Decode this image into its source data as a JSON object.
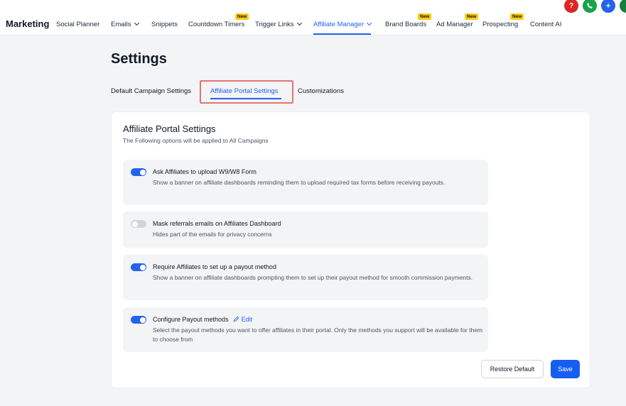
{
  "nav": {
    "brand": "Marketing",
    "items": [
      {
        "label": "Social Planner"
      },
      {
        "label": "Emails"
      },
      {
        "label": "Snippets"
      },
      {
        "label": "Countdown Timers",
        "badge": "New"
      },
      {
        "label": "Trigger Links"
      },
      {
        "label": "Affiliate Manager"
      },
      {
        "label": "Brand Boards",
        "badge": "New"
      },
      {
        "label": "Ad Manager",
        "badge": "New"
      },
      {
        "label": "Prospecting",
        "badge": "New"
      },
      {
        "label": "Content AI"
      }
    ],
    "colors": {
      "active": "#2563eb",
      "badge": "#facc15"
    }
  },
  "header_buttons": [
    {
      "icon": "help-icon",
      "color": "#dc2626"
    },
    {
      "icon": "phone-icon",
      "color": "#16a34a"
    },
    {
      "icon": "sparkle-icon",
      "color": "#2563eb"
    },
    {
      "icon": "partial-icon",
      "color": "#15803d"
    }
  ],
  "page": {
    "title": "Settings",
    "tabs": [
      {
        "label": "Default Campaign Settings"
      },
      {
        "label": "Affiliate Portal Settings",
        "active": true
      },
      {
        "label": "Customizations"
      }
    ]
  },
  "card": {
    "title": "Affiliate Portal Settings",
    "subtitle": "The Following options will be applied to All Campaigns",
    "settings": [
      {
        "title": "Ask Affiliates to upload W9/W8 Form",
        "description": "Show a banner on affiliate dashboards reminding them to upload required tax forms before receiving payouts.",
        "enabled": true
      },
      {
        "title": "Mask referrals emails on Affiliates Dashboard",
        "description": "Hides part of the emails for privacy concerns",
        "enabled": false
      },
      {
        "title": "Require Affiliates to set up a payout method",
        "description": "Show a banner on affiliate dashboards prompting them to set up their payout method for smooth commission payments.",
        "enabled": true
      },
      {
        "title": "Configure Payout methods",
        "edit_label": "Edit",
        "description": "Select the payout methods you want to offer affiliates in their portal. Only the methods you support will be available for them to choose from",
        "enabled": true
      }
    ],
    "restore_label": "Restore Default",
    "save_label": "Save"
  }
}
